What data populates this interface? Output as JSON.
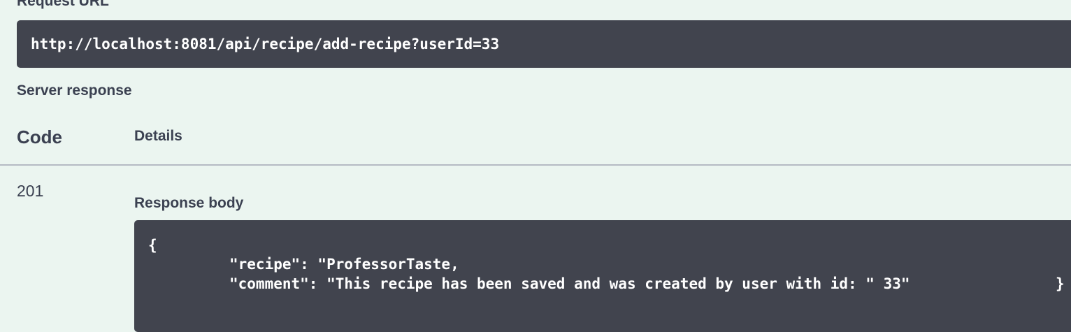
{
  "request_url": {
    "label": "Request URL",
    "value": "http://localhost:8081/api/recipe/add-recipe?userId=33"
  },
  "server_response": {
    "label": "Server response",
    "columns": {
      "code": "Code",
      "details": "Details"
    },
    "row": {
      "code": "201",
      "response_body_label": "Response body",
      "body_lines": {
        "open": "{",
        "recipe": "\"recipe\": \"ProfessorTaste,",
        "comment": "\"comment\": \"This recipe has been saved and was created by user with id: \" 33\"",
        "close": "}"
      }
    }
  },
  "colors": {
    "background": "#ebf5f0",
    "code_box": "#41444e",
    "text": "#3b4151",
    "code_text": "#ffffff"
  }
}
